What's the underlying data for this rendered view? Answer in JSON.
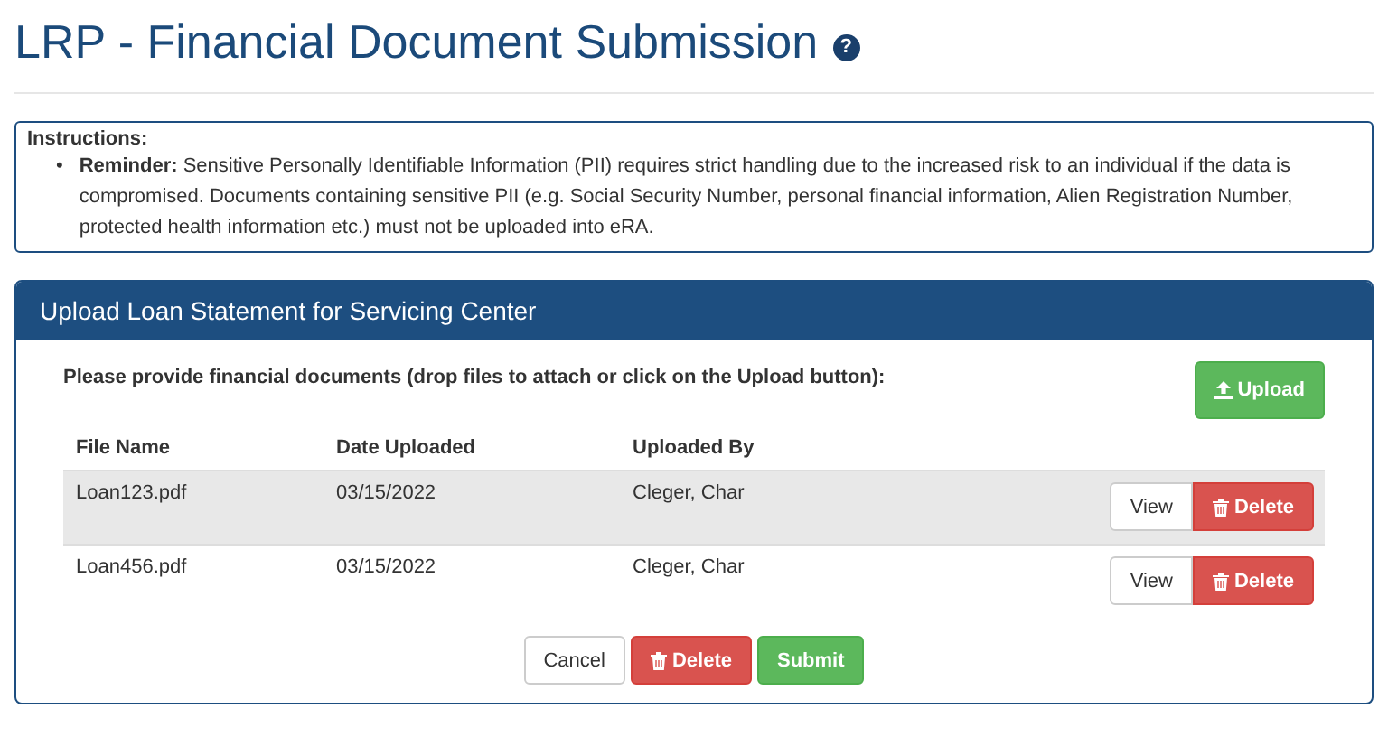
{
  "page_title": "LRP - Financial Document Submission",
  "help_icon": "?",
  "instructions": {
    "heading": "Instructions:",
    "items": [
      {
        "marker": "•",
        "text": "**Reminder:** Sensitive Personally Identifiable Information (PII) requires strict handling due to the increased risk to an individual if the data is compromised. Documents containing sensitive PII (e.g. Social Security Number, personal financial information, Alien Registration Number, protected health information etc.) must not be uploaded into eRA."
      }
    ]
  },
  "panel": {
    "title": "Upload Loan Statement for Servicing Center",
    "prompt": "Please provide financial documents (drop files to attach or click on the Upload button):",
    "upload_button": "Upload",
    "table": {
      "columns": [
        "File Name",
        "Date Uploaded",
        "Uploaded By"
      ],
      "rows": [
        {
          "cells": [
            "Loan123.pdf",
            "03/15/2022",
            "Cleger, Char"
          ],
          "shaded": true,
          "actions": [
            "View",
            "Delete"
          ]
        },
        {
          "cells": [
            "Loan456.pdf",
            "03/15/2022",
            "Cleger, Char"
          ],
          "shaded": false,
          "actions": [
            "View",
            "Delete"
          ]
        }
      ]
    },
    "buttons": [
      {
        "label": "Cancel",
        "kind": "default"
      },
      {
        "label": "Delete",
        "kind": "danger"
      },
      {
        "label": "Submit",
        "kind": "success"
      }
    ]
  }
}
